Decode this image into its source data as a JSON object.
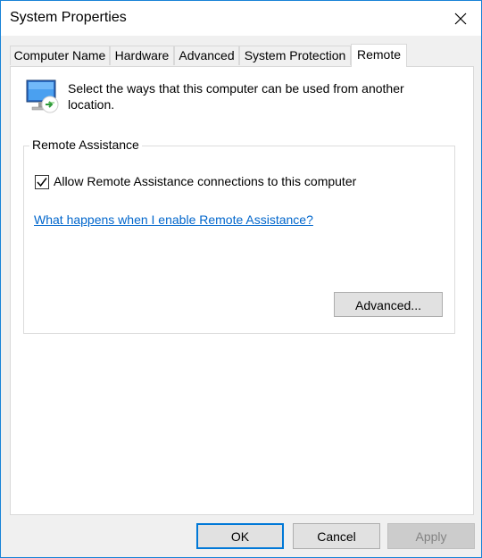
{
  "window": {
    "title": "System Properties"
  },
  "tabs": [
    {
      "label": "Computer Name",
      "active": false
    },
    {
      "label": "Hardware",
      "active": false
    },
    {
      "label": "Advanced",
      "active": false
    },
    {
      "label": "System Protection",
      "active": false
    },
    {
      "label": "Remote",
      "active": true
    }
  ],
  "remote": {
    "intro": "Select the ways that this computer can be used from another location.",
    "icon": "remote-monitor-icon",
    "assistance": {
      "group_title": "Remote Assistance",
      "checkbox_label": "Allow Remote Assistance connections to this computer",
      "checked": true,
      "help_link": "What happens when I enable Remote Assistance?",
      "advanced_button": "Advanced..."
    }
  },
  "footer": {
    "ok": "OK",
    "cancel": "Cancel",
    "apply": "Apply",
    "apply_enabled": false
  },
  "colors": {
    "accent": "#0078d7",
    "link": "#0066cc",
    "window_border": "#1883d7"
  }
}
